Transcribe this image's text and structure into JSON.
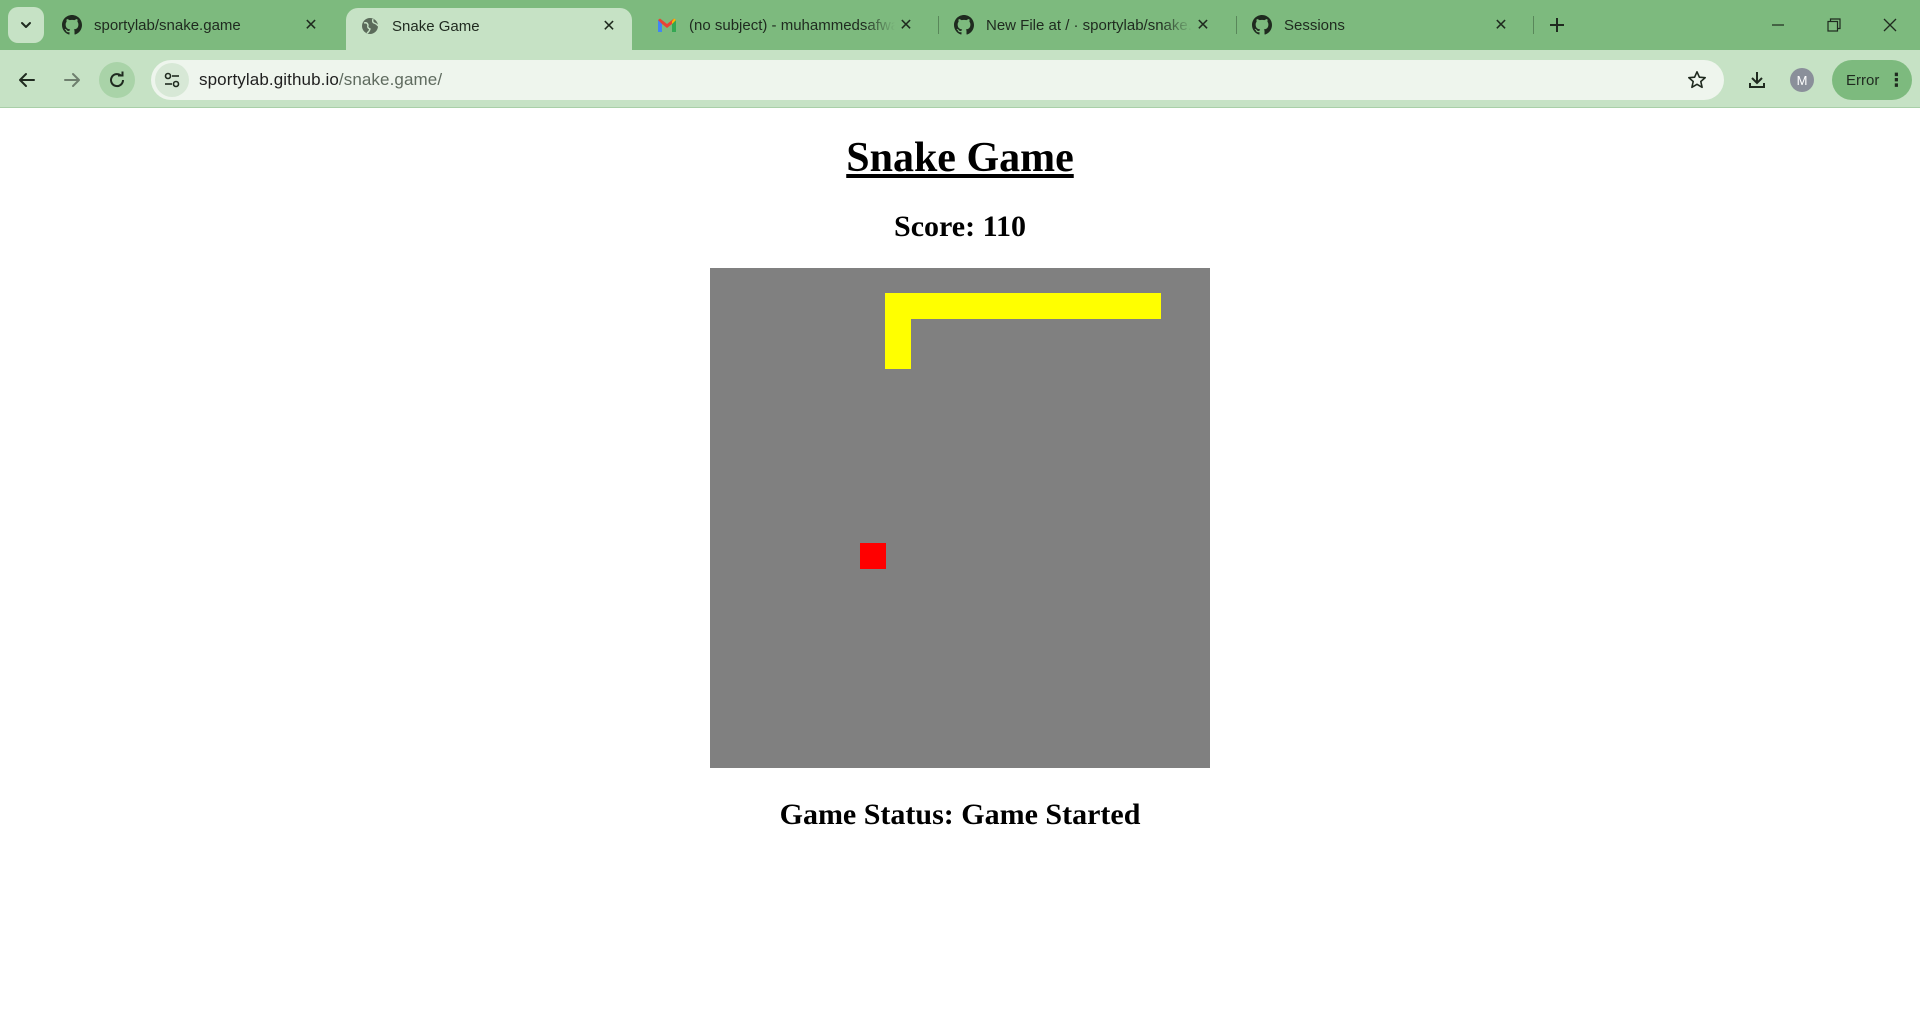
{
  "browser": {
    "tabs": [
      {
        "title": "sportylab/snake.game",
        "favicon": "github-icon",
        "active": false
      },
      {
        "title": "Snake Game",
        "favicon": "globe-icon",
        "active": true
      },
      {
        "title": "(no subject) - muhammedsafwa",
        "favicon": "gmail-icon",
        "active": false
      },
      {
        "title": "New File at / · sportylab/snake.g",
        "favicon": "github-icon",
        "active": false
      },
      {
        "title": "Sessions",
        "favicon": "github-icon",
        "active": false
      }
    ],
    "url_host": "sportylab.github.io",
    "url_path": "/snake.game/",
    "profile_initial": "M",
    "error_label": "Error",
    "colors": {
      "frame": "#7dba7e",
      "toolbar": "#c6e2c5",
      "omnibox": "#eef5ed"
    }
  },
  "page": {
    "title": "Snake Game",
    "score_text": "Score: 110",
    "status_text": "Game Status: Game Started"
  },
  "game": {
    "grid_size": 20,
    "board_color": "#808080",
    "snake_color": "#ffff00",
    "food_color": "#ff0000",
    "snake": [
      [
        17,
        1
      ],
      [
        16,
        1
      ],
      [
        15,
        1
      ],
      [
        14,
        1
      ],
      [
        13,
        1
      ],
      [
        12,
        1
      ],
      [
        11,
        1
      ],
      [
        10,
        1
      ],
      [
        9,
        1
      ],
      [
        8,
        1
      ],
      [
        7,
        1
      ],
      [
        7,
        2
      ],
      [
        7,
        3
      ]
    ],
    "food": [
      6,
      11
    ]
  }
}
